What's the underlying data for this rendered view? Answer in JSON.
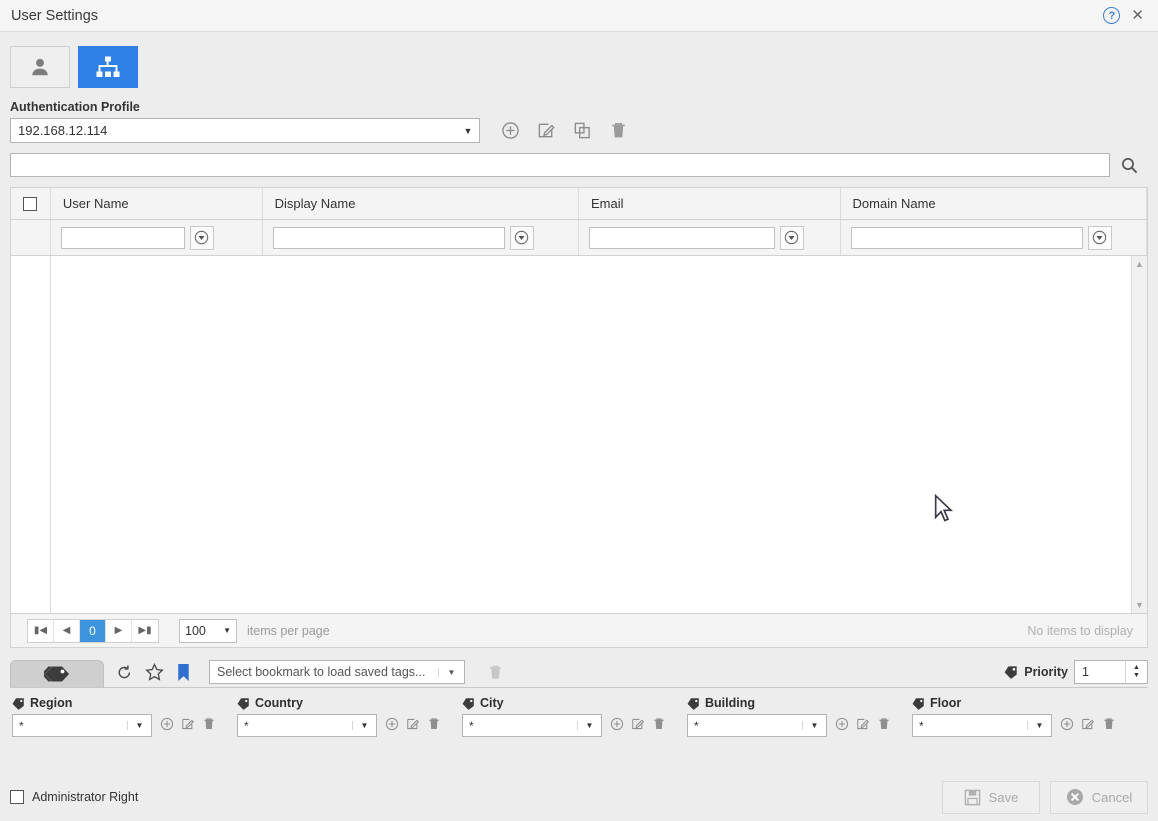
{
  "window": {
    "title": "User Settings",
    "help_icon": "help-circle-icon",
    "close_icon": "close-icon"
  },
  "top_tabs": [
    {
      "name": "user-tab",
      "icon": "user-icon",
      "active": false
    },
    {
      "name": "organization-tab",
      "icon": "org-chart-icon",
      "active": true
    }
  ],
  "auth": {
    "label": "Authentication Profile",
    "value": "192.168.12.114",
    "dropdown_arrow": "▼",
    "tools": [
      {
        "name": "add-profile-icon",
        "label": "add-circle-icon"
      },
      {
        "name": "edit-profile-icon",
        "label": "edit-pencil-icon"
      },
      {
        "name": "copy-profile-icon",
        "label": "copy-icon"
      },
      {
        "name": "delete-profile-icon",
        "label": "trash-icon"
      }
    ]
  },
  "search": {
    "value": "",
    "placeholder": "",
    "icon": "search-icon"
  },
  "grid": {
    "select_all_checked": false,
    "columns": [
      {
        "header": "User Name",
        "filter_value": "",
        "filter_icon": "filter-dropdown-icon"
      },
      {
        "header": "Display Name",
        "filter_value": "",
        "filter_icon": "filter-dropdown-icon"
      },
      {
        "header": "Email",
        "filter_value": "",
        "filter_icon": "filter-dropdown-icon"
      },
      {
        "header": "Domain Name",
        "filter_value": "",
        "filter_icon": "filter-dropdown-icon"
      }
    ],
    "rows": [],
    "empty_message": "No items to display"
  },
  "pager": {
    "first": "⏮",
    "prev": "◀",
    "current_page": "0",
    "next": "▶",
    "last": "⏭",
    "page_size": "100",
    "page_size_arrow": "▼",
    "items_per_page_label": "items per page"
  },
  "tagbar": {
    "tab_icon": "tags-icon",
    "tools": [
      {
        "name": "reset-tags-icon",
        "glyph": "↺"
      },
      {
        "name": "favorite-star-icon",
        "glyph": "☆"
      },
      {
        "name": "bookmark-flag-icon",
        "glyph": "⚑"
      }
    ],
    "bookmark_value": "Select bookmark to load saved tags...",
    "bookmark_arrow": "▼",
    "delete_bookmark_icon": "trash-icon",
    "priority_label": "Priority",
    "priority_value": "1",
    "priority_up": "▲",
    "priority_down": "▼"
  },
  "tag_fields": [
    {
      "label": "Region",
      "value": "*",
      "arrow": "▼"
    },
    {
      "label": "Country",
      "value": "*",
      "arrow": "▼"
    },
    {
      "label": "City",
      "value": "*",
      "arrow": "▼"
    },
    {
      "label": "Building",
      "value": "*",
      "arrow": "▼"
    },
    {
      "label": "Floor",
      "value": "*",
      "arrow": "▼"
    }
  ],
  "tag_field_icons": [
    {
      "name": "add-tag-icon"
    },
    {
      "name": "edit-tag-icon"
    },
    {
      "name": "delete-tag-icon"
    }
  ],
  "footer": {
    "admin_right_label": "Administrator Right",
    "admin_right_checked": false,
    "save_label": "Save",
    "save_icon": "save-floppy-icon",
    "cancel_label": "Cancel",
    "cancel_icon": "cancel-circle-icon"
  },
  "colors": {
    "accent": "#2f80e5",
    "pager_active": "#3e93dd",
    "bookmark_blue": "#2f6fd0",
    "window_bg": "#ededed"
  }
}
